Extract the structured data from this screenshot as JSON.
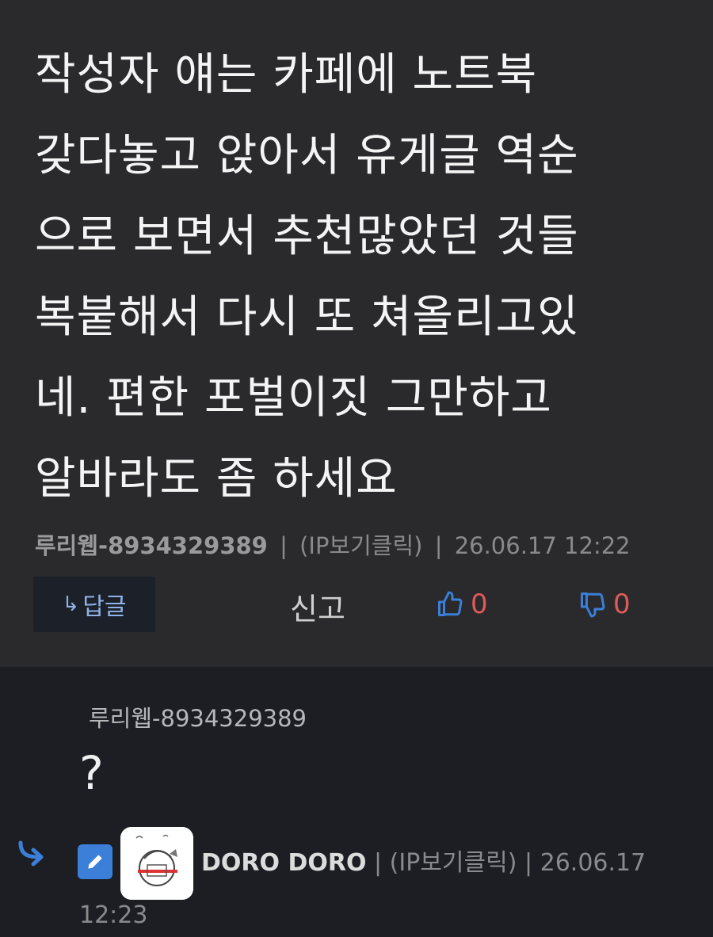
{
  "comment": {
    "text": "작성자 얘는 카페에 노트북\n갖다놓고 앉아서 유게글 역순\n으로 보면서 추천많았던 것들\n복붙해서 다시 또 쳐올리고있\n네. 편한 포벌이짓 그만하고\n알바라도 좀 하세요",
    "author": "루리웹-8934329389",
    "ip": "(IP보기클릭)",
    "timestamp": "26.06.17 12:22",
    "separator": "|",
    "reply_label": "답글",
    "reply_arrow": "↳",
    "report_label": "신고",
    "upvotes": "0",
    "downvotes": "0"
  },
  "reply": {
    "author": "루리웹-8934329389",
    "text": "?"
  },
  "next_reply": {
    "author": "DORO DORO",
    "ip": "(IP보기클릭)",
    "date": "26.06.17",
    "time": "12:23",
    "separator": "|"
  },
  "colors": {
    "top_bg": "#2a2a2c",
    "bottom_bg": "#1c1e24",
    "accent_blue": "#3b7fd8",
    "vote_red": "#e05a5a"
  },
  "icons": [
    "reply-arrow-icon",
    "thumbs-up-icon",
    "thumbs-down-icon",
    "edit-icon",
    "avatar-icon"
  ]
}
